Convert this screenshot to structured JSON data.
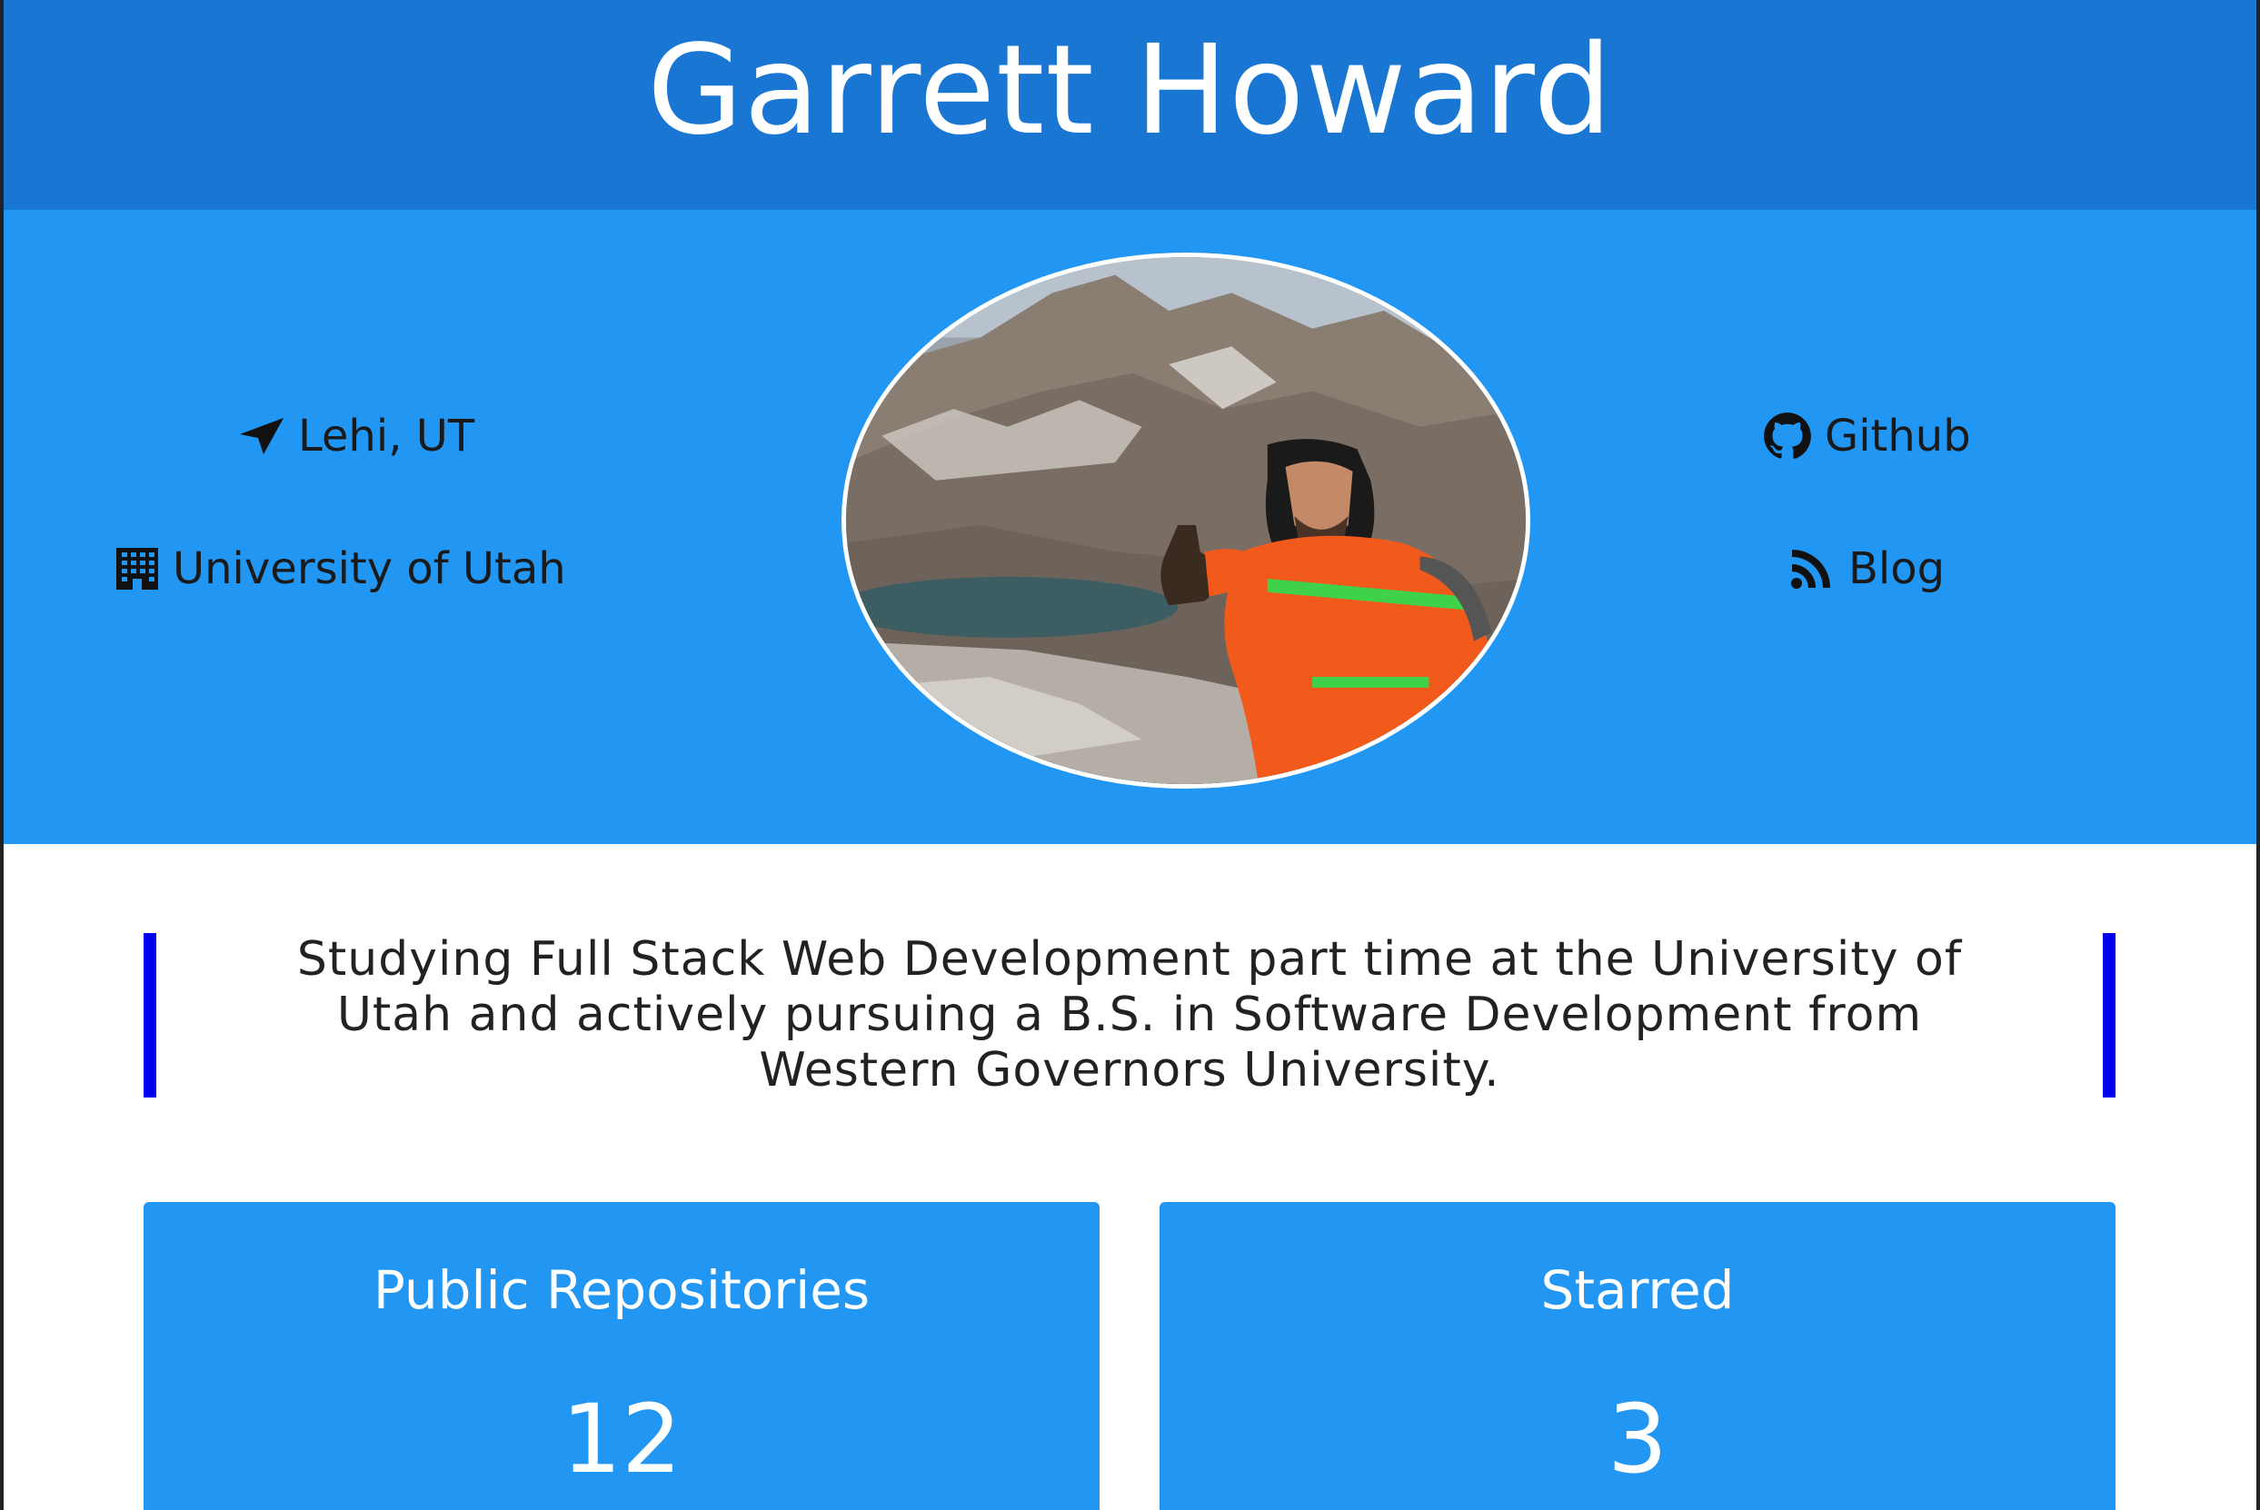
{
  "header": {
    "title": "Garrett Howard",
    "background": "#1976d2"
  },
  "hero": {
    "background": "#2196f3",
    "location": {
      "icon": "location-arrow-icon",
      "label": "Lehi, UT"
    },
    "school": {
      "icon": "building-icon",
      "label": "University of Utah"
    },
    "github": {
      "icon": "github-icon",
      "label": "Github"
    },
    "blog": {
      "icon": "rss-icon",
      "label": "Blog"
    },
    "avatar": {
      "description": "profile-photo"
    }
  },
  "bio": {
    "text": "Studying Full Stack Web Development part time at the University of Utah and actively pursuing a B.S. in Software Development from Western Governors University.",
    "accent": "#0000ee"
  },
  "stats": [
    {
      "label": "Public Repositories",
      "value": "12"
    },
    {
      "label": "Starred",
      "value": "3"
    }
  ]
}
